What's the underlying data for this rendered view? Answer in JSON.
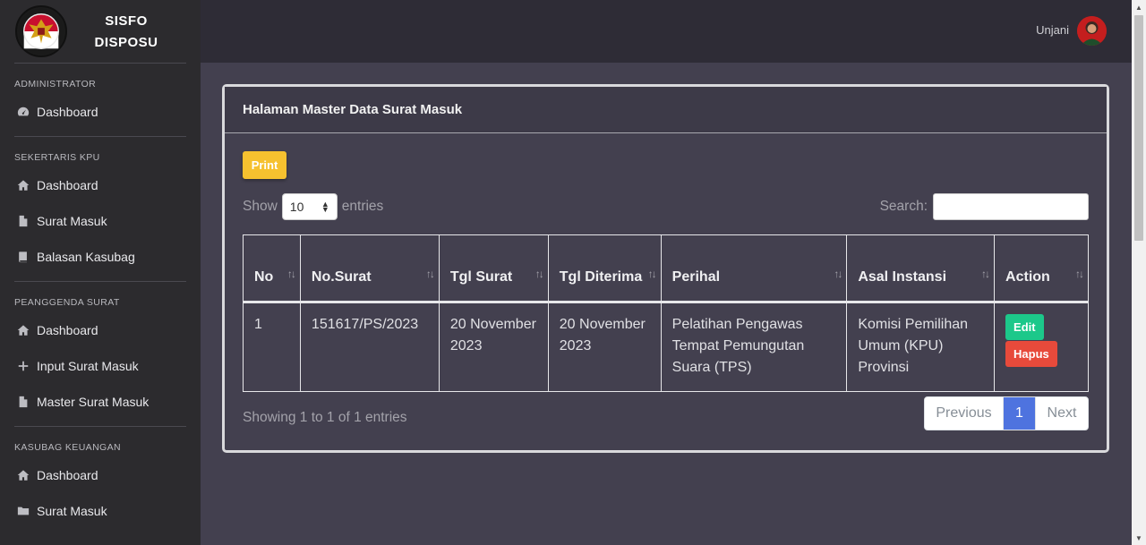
{
  "brand": {
    "line1": "SISFO",
    "line2": "DISPOSU"
  },
  "sidebar": {
    "sections": [
      {
        "title": "ADMINISTRATOR",
        "items": [
          {
            "label": "Dashboard",
            "icon": "tachometer-icon"
          }
        ]
      },
      {
        "title": "SEKERTARIS KPU",
        "items": [
          {
            "label": "Dashboard",
            "icon": "home-icon"
          },
          {
            "label": "Surat Masuk",
            "icon": "file-icon"
          },
          {
            "label": "Balasan Kasubag",
            "icon": "book-icon"
          }
        ]
      },
      {
        "title": "PEANGGENDA SURAT",
        "items": [
          {
            "label": "Dashboard",
            "icon": "home-icon"
          },
          {
            "label": "Input Surat Masuk",
            "icon": "plus-icon"
          },
          {
            "label": "Master Surat Masuk",
            "icon": "file-icon"
          }
        ]
      },
      {
        "title": "KASUBAG KEUANGAN",
        "items": [
          {
            "label": "Dashboard",
            "icon": "home-icon"
          },
          {
            "label": "Surat Masuk",
            "icon": "folder-icon"
          }
        ]
      }
    ]
  },
  "topbar": {
    "user": "Unjani"
  },
  "card": {
    "title": "Halaman Master Data Surat Masuk",
    "print_label": "Print",
    "show_label": "Show",
    "entries_label": "entries",
    "page_size": "10",
    "search_label": "Search:",
    "search_value": ""
  },
  "table": {
    "headers": [
      "No",
      "No.Surat",
      "Tgl Surat",
      "Tgl Diterima",
      "Perihal",
      "Asal Instansi",
      "Action"
    ],
    "rows": [
      {
        "no": "1",
        "no_surat": "151617/PS/2023",
        "tgl_surat": "20 November 2023",
        "tgl_diterima": "20 November 2023",
        "perihal": "Pelatihan Pengawas Tempat Pemungutan Suara (TPS)",
        "asal_instansi": "Komisi Pemilihan Umum (KPU) Provinsi",
        "edit_label": "Edit",
        "hapus_label": "Hapus"
      }
    ]
  },
  "footer": {
    "info": "Showing 1 to 1 of 1 entries",
    "previous": "Previous",
    "current_page": "1",
    "next": "Next"
  },
  "colors": {
    "print": "#f6c12f",
    "edit": "#1cc88a",
    "hapus": "#e74a3b",
    "active_page": "#4e73df"
  }
}
